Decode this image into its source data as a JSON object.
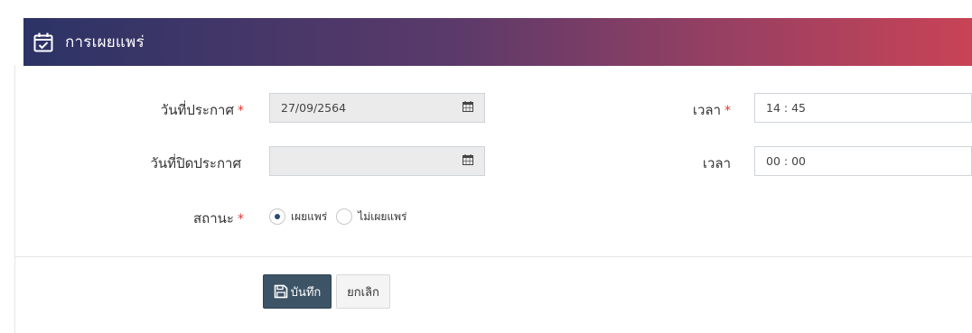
{
  "header": {
    "title": "การเผยแพร่",
    "icon": "calendar-check-icon"
  },
  "form": {
    "publish_date": {
      "label": "วันที่ประกาศ",
      "required": "*",
      "value": "27/09/2564",
      "icon": "calendar-icon"
    },
    "publish_time": {
      "label": "เวลา",
      "required": "*",
      "value": "14 : 45"
    },
    "close_date": {
      "label": "วันที่ปิดประกาศ",
      "value": "",
      "icon": "calendar-icon"
    },
    "close_time": {
      "label": "เวลา",
      "value": "00 : 00"
    },
    "status": {
      "label": "สถานะ",
      "required": "*",
      "options": [
        {
          "label": "เผยแพร่",
          "checked": true
        },
        {
          "label": "ไม่เผยแพร่",
          "checked": false
        }
      ]
    }
  },
  "actions": {
    "save_label": "บันทึก",
    "save_icon": "floppy-disk-icon",
    "cancel_label": "ยกเลิก"
  },
  "colors": {
    "header_start": "#2c3366",
    "header_end": "#c84356",
    "required": "#e3342f",
    "save_button": "#3d5466"
  }
}
